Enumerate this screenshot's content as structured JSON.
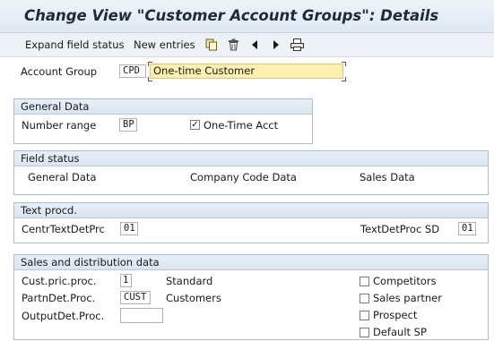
{
  "window": {
    "title": "Change View \"Customer Account Groups\": Details"
  },
  "toolbar": {
    "expand_field_status": "Expand field status",
    "new_entries": "New entries",
    "icons": [
      "copy-icon",
      "delete-icon",
      "previous-icon",
      "next-icon",
      "print-icon"
    ]
  },
  "account_group": {
    "label": "Account Group",
    "code": "CPD",
    "name": "One-time Customer"
  },
  "general_data": {
    "header": "General Data",
    "number_range_label": "Number range",
    "number_range_value": "BP",
    "one_time_acct_label": "One-Time Acct",
    "one_time_acct_checked": true
  },
  "field_status": {
    "header": "Field status",
    "general_data": "General Data",
    "company_code_data": "Company Code Data",
    "sales_data": "Sales Data"
  },
  "text_procd": {
    "header": "Text procd.",
    "centr_label": "CentrTextDetPrc",
    "centr_value": "01",
    "sd_label": "TextDetProc SD",
    "sd_value": "01"
  },
  "sales_distribution": {
    "header": "Sales and distribution data",
    "cust_pric_label": "Cust.pric.proc.",
    "cust_pric_value": "1",
    "cust_pric_desc": "Standard",
    "partn_label": "PartnDet.Proc.",
    "partn_value": "CUST",
    "partn_desc": "Customers",
    "output_label": "OutputDet.Proc.",
    "output_value": "",
    "checkboxes": [
      {
        "label": "Competitors",
        "checked": false
      },
      {
        "label": "Sales partner",
        "checked": false
      },
      {
        "label": "Prospect",
        "checked": false
      },
      {
        "label": "Default SP",
        "checked": false
      }
    ]
  },
  "colors": {
    "title_bar": "#dfe8f2",
    "group_border": "#a9bdd3",
    "required_field": "#fdf0b0",
    "required_marker": "#cc2a2a"
  }
}
